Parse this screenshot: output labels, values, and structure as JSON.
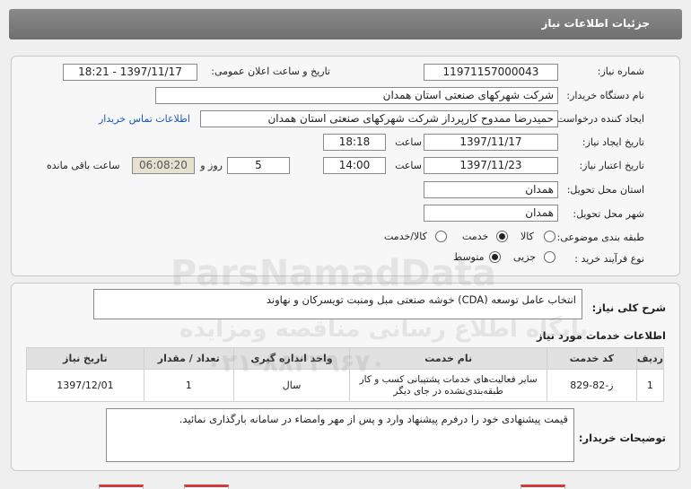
{
  "header": {
    "title": "جزئیات اطلاعات نیاز"
  },
  "fields": {
    "need_number_label": "شماره نیاز:",
    "need_number": "11971157000043",
    "announce_label": "تاریخ و ساعت اعلان عمومی:",
    "announce_value": "1397/11/17 - 18:21",
    "buyer_org_label": "نام دستگاه خریدار:",
    "buyer_org": "شرکت شهرکهای صنعتی استان همدان",
    "requester_label": "ایجاد کننده درخواست:",
    "requester": "حمیدرضا ممدوح کارپرداز شرکت شهرکهای صنعتی استان همدان",
    "contact_link": "اطلاعات تماس خریدار",
    "created_label": "تاریخ ایجاد نیاز:",
    "created_date": "1397/11/17",
    "time_label": "ساعت",
    "created_time": "18:18",
    "validity_label": "تاریخ اعتبار نیاز:",
    "validity_date": "1397/11/23",
    "validity_time": "14:00",
    "days_value": "5",
    "days_label": "روز و",
    "countdown": "06:08:20",
    "remaining_label": "ساعت باقی مانده",
    "province_label": "استان محل تحویل:",
    "province": "همدان",
    "city_label": "شهر محل تحویل:",
    "city": "همدان",
    "category_label": "طبقه بندی موضوعی:",
    "category_options": [
      "کالا",
      "خدمت",
      "کالا/خدمت"
    ],
    "category_selected": "خدمت",
    "process_label": "نوع فرآیند خرید :",
    "process_options": [
      "جزیی",
      "متوسط"
    ],
    "process_selected": "متوسط"
  },
  "summary": {
    "label": "شرح کلی نیاز:",
    "text": "انتخاب عامل توسعه (CDA) خوشه صنعتی مبل ومنبت تویسرکان و نهاوند"
  },
  "services": {
    "title": "اطلاعات خدمات مورد نیاز",
    "columns": [
      "ردیف",
      "کد خدمت",
      "نام خدمت",
      "واحد اندازه گیری",
      "تعداد / مقدار",
      "تاریخ نیاز"
    ],
    "rows": [
      [
        "1",
        "ز-82-829",
        "سایر فعالیت‌های خدمات پشتیبانی کسب و کار طبقه‌بندی‌نشده در جای دیگر",
        "سال",
        "1",
        "1397/12/01"
      ]
    ]
  },
  "buyer_notes": {
    "label": "توضیحات خریدار:",
    "text": "قیمت پیشنهادی خود را درفرم پیشنهاد وارد و پس از مهر وامضاء در سامانه بارگذاری نمائید."
  },
  "watermarks": [
    "ParsNamadData",
    "پایگاه اطلاع رسانی مناقصه ومزایده",
    "۰۲۱-۸۸۳۴۹۶۷۰"
  ]
}
